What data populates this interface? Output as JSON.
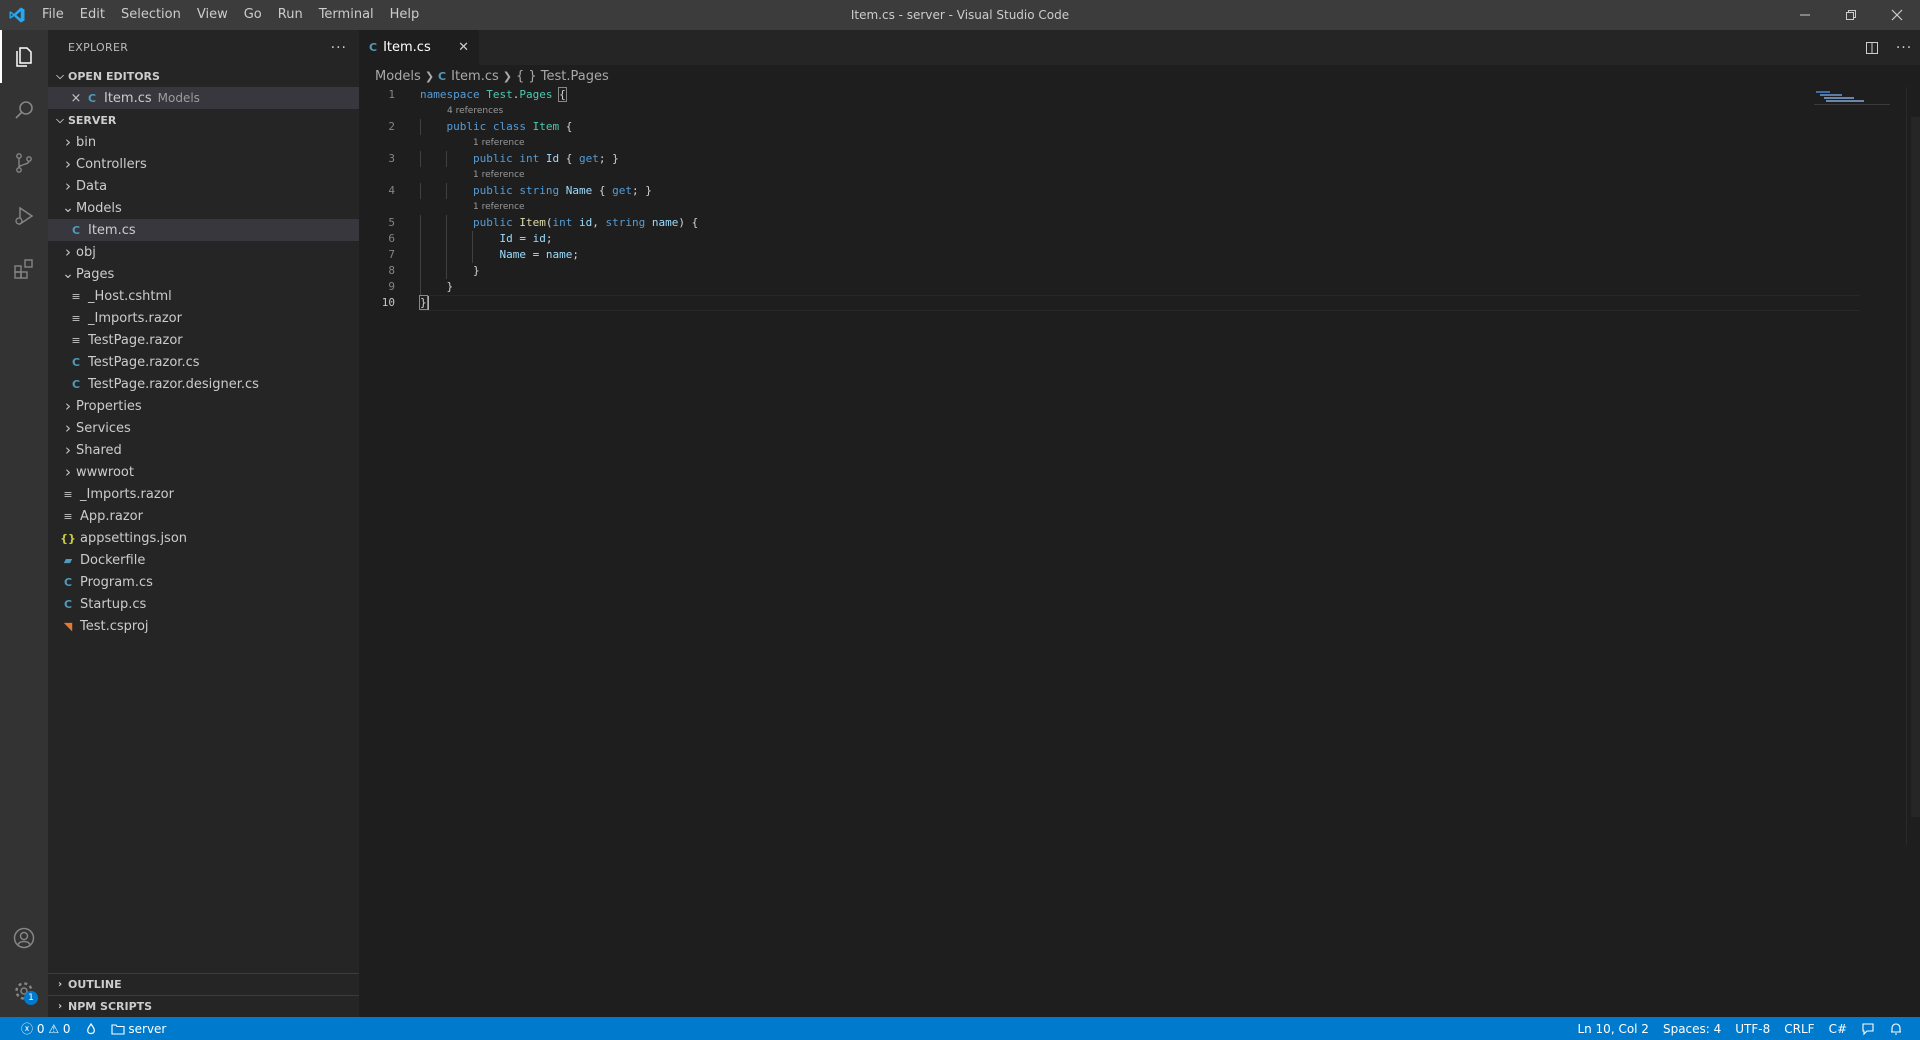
{
  "window": {
    "title": "Item.cs - server - Visual Studio Code",
    "menu": [
      "File",
      "Edit",
      "Selection",
      "View",
      "Go",
      "Run",
      "Terminal",
      "Help"
    ]
  },
  "sidebar": {
    "header": "EXPLORER",
    "open_editors": {
      "title": "OPEN EDITORS",
      "items": [
        {
          "name": "Item.cs",
          "desc": "Models"
        }
      ]
    },
    "folder": {
      "title": "SERVER",
      "items": [
        {
          "label": "bin",
          "kind": "folder-closed",
          "depth": 0,
          "icon": "chevron-right"
        },
        {
          "label": "Controllers",
          "kind": "folder-closed",
          "depth": 0,
          "icon": "chevron-right"
        },
        {
          "label": "Data",
          "kind": "folder-closed",
          "depth": 0,
          "icon": "chevron-right"
        },
        {
          "label": "Models",
          "kind": "folder-open",
          "depth": 0,
          "icon": "chevron-down"
        },
        {
          "label": "Item.cs",
          "kind": "file",
          "depth": 1,
          "icon": "csharp",
          "selected": true
        },
        {
          "label": "obj",
          "kind": "folder-closed",
          "depth": 0,
          "icon": "chevron-right"
        },
        {
          "label": "Pages",
          "kind": "folder-open",
          "depth": 0,
          "icon": "chevron-down"
        },
        {
          "label": "_Host.cshtml",
          "kind": "file",
          "depth": 1,
          "icon": "lines"
        },
        {
          "label": "_Imports.razor",
          "kind": "file",
          "depth": 1,
          "icon": "lines"
        },
        {
          "label": "TestPage.razor",
          "kind": "file",
          "depth": 1,
          "icon": "lines"
        },
        {
          "label": "TestPage.razor.cs",
          "kind": "file",
          "depth": 1,
          "icon": "csharp"
        },
        {
          "label": "TestPage.razor.designer.cs",
          "kind": "file",
          "depth": 1,
          "icon": "csharp"
        },
        {
          "label": "Properties",
          "kind": "folder-closed",
          "depth": 0,
          "icon": "chevron-right"
        },
        {
          "label": "Services",
          "kind": "folder-closed",
          "depth": 0,
          "icon": "chevron-right"
        },
        {
          "label": "Shared",
          "kind": "folder-closed",
          "depth": 0,
          "icon": "chevron-right"
        },
        {
          "label": "wwwroot",
          "kind": "folder-closed",
          "depth": 0,
          "icon": "chevron-right"
        },
        {
          "label": "_Imports.razor",
          "kind": "file",
          "depth": 0,
          "icon": "lines"
        },
        {
          "label": "App.razor",
          "kind": "file",
          "depth": 0,
          "icon": "lines"
        },
        {
          "label": "appsettings.json",
          "kind": "file",
          "depth": 0,
          "icon": "json"
        },
        {
          "label": "Dockerfile",
          "kind": "file",
          "depth": 0,
          "icon": "docker"
        },
        {
          "label": "Program.cs",
          "kind": "file",
          "depth": 0,
          "icon": "csharp"
        },
        {
          "label": "Startup.cs",
          "kind": "file",
          "depth": 0,
          "icon": "csharp"
        },
        {
          "label": "Test.csproj",
          "kind": "file",
          "depth": 0,
          "icon": "rss"
        }
      ]
    },
    "outline": "OUTLINE",
    "npm_scripts": "NPM SCRIPTS"
  },
  "editor": {
    "tab": "Item.cs",
    "breadcrumb": [
      "Models",
      "Item.cs",
      "{ } Test.Pages"
    ],
    "lens": {
      "ns": "4 references",
      "p1": "1 reference",
      "p2": "1 reference",
      "ctor": "1 reference"
    },
    "line_numbers": [
      "1",
      "2",
      "3",
      "4",
      "5",
      "6",
      "7",
      "8",
      "9",
      "10"
    ]
  },
  "status": {
    "errors": "0",
    "warnings": "0",
    "folder": "server",
    "position": "Ln 10, Col 2",
    "spaces": "Spaces: 4",
    "encoding": "UTF-8",
    "eol": "CRLF",
    "language": "C#"
  },
  "accounts_badge": "1",
  "colors": {
    "statusbar": "#007acc",
    "titlebar": "#3c3c3c",
    "sidebar": "#252526",
    "editor": "#1e1e1e",
    "activitybar": "#333333"
  }
}
